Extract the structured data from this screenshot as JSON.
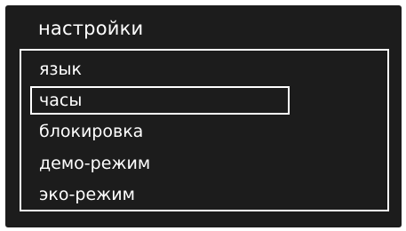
{
  "colors": {
    "background": "#1c1c1c",
    "text": "#ffffff",
    "border": "#ffffff"
  },
  "header": {
    "title": "настройки"
  },
  "menu": {
    "selected_index": 1,
    "items": [
      {
        "label": "язык"
      },
      {
        "label": "часы"
      },
      {
        "label": "блокировка"
      },
      {
        "label": "демо-режим"
      },
      {
        "label": "эко-режим"
      }
    ]
  }
}
